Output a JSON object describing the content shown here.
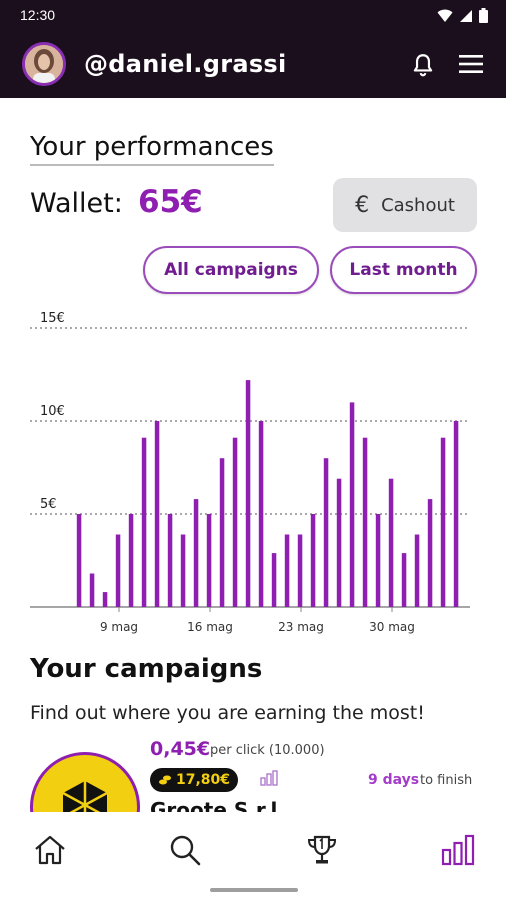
{
  "status": {
    "time": "12:30"
  },
  "header": {
    "username": "@daniel.grassi"
  },
  "performance": {
    "title": "Your performances",
    "wallet_label": "Wallet:",
    "wallet_amount": "65€",
    "cashout_label": "Cashout",
    "cashout_symbol": "€",
    "filters": [
      "All campaigns",
      "Last month"
    ]
  },
  "chart_data": {
    "type": "bar",
    "y_ticks": [
      "15€",
      "10€",
      "5€"
    ],
    "y_tick_values": [
      15,
      10,
      5
    ],
    "ylim": [
      0,
      15.5
    ],
    "x_tick_labels": [
      "9 mag",
      "16 mag",
      "23 mag",
      "30 mag"
    ],
    "x_tick_indices": [
      2,
      9,
      16,
      23
    ],
    "values": [
      5,
      1.8,
      0.8,
      3.9,
      5,
      9.1,
      10,
      5,
      3.9,
      5.8,
      5,
      8,
      9.1,
      12.2,
      10,
      2.9,
      3.9,
      3.9,
      5,
      8,
      6.9,
      11,
      9.1,
      5,
      6.9,
      2.9,
      3.9,
      5.8,
      9.1,
      10
    ],
    "grid": "dotted",
    "bar_color": "#8e1fb0"
  },
  "campaigns": {
    "title": "Your campaigns",
    "subtitle": "Find out where you are earning the most!",
    "items": [
      {
        "price": "0,45€",
        "per_click": "per click (10.000)",
        "earned": "17,80€",
        "days": "9 days",
        "days_tail": "to finish",
        "name": "Groote S.r.l."
      }
    ]
  },
  "nav": [
    "home-icon",
    "search-icon",
    "trophy-icon",
    "stats-icon"
  ],
  "colors": {
    "accent": "#8e1fb0",
    "header_bg": "#1c0f1d",
    "logo_yellow": "#f3cf11"
  }
}
